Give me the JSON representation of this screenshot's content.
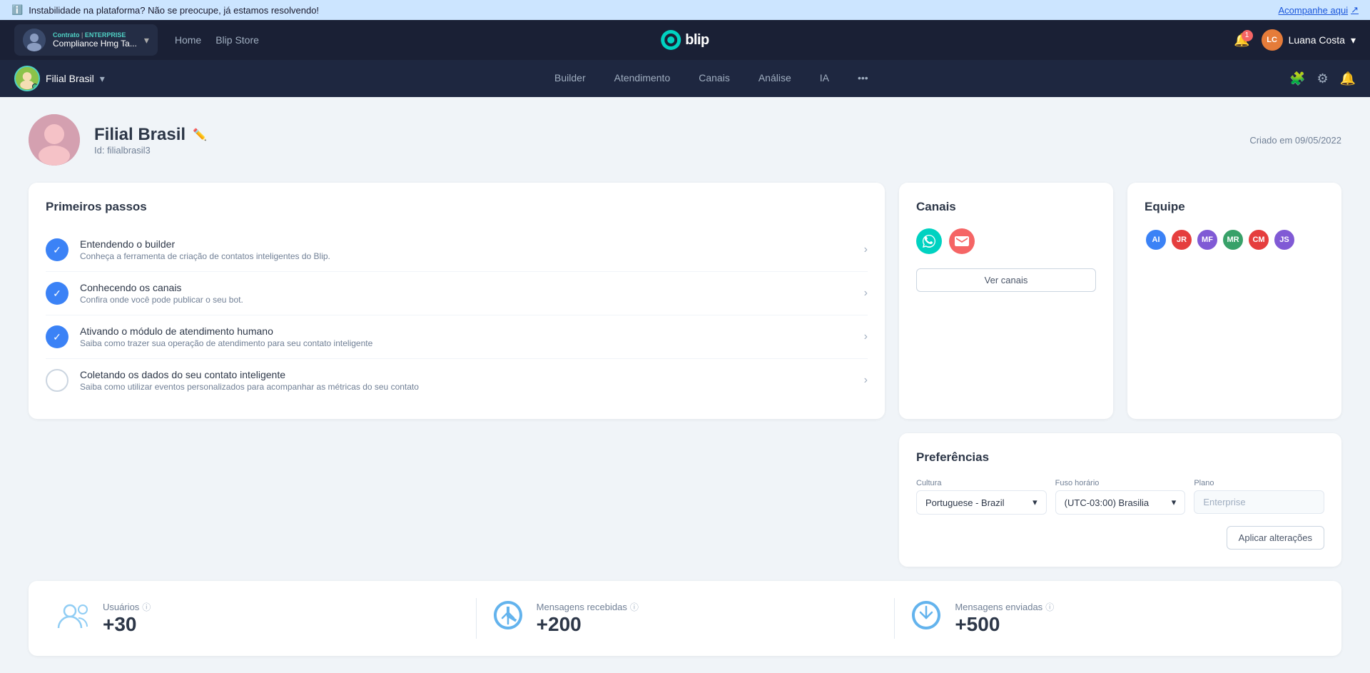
{
  "alert": {
    "message": "Instabilidade na plataforma? Não se preocupe, já estamos resolvendo!",
    "link_text": "Acompanhe aqui",
    "info_icon": "ℹ"
  },
  "top_nav": {
    "contract_badge": "Contrato",
    "contract_tier": "ENTERPRISE",
    "contract_name": "Compliance Hmg Ta...",
    "links": [
      {
        "label": "Home",
        "active": false
      },
      {
        "label": "Blip Store",
        "active": false
      }
    ],
    "logo_text": "blip",
    "notifications_count": "1",
    "user_name": "Luana Costa",
    "user_initials": "LC"
  },
  "sub_nav": {
    "bot_name": "Filial Brasil",
    "links": [
      {
        "label": "Builder",
        "active": false
      },
      {
        "label": "Atendimento",
        "active": false
      },
      {
        "label": "Canais",
        "active": false
      },
      {
        "label": "Análise",
        "active": false
      },
      {
        "label": "IA",
        "active": false
      },
      {
        "label": "•••",
        "active": false
      }
    ]
  },
  "profile": {
    "name": "Filial Brasil",
    "id": "Id: filialbrasil3",
    "created": "Criado em  09/05/2022"
  },
  "primeiros_passos": {
    "title": "Primeiros passos",
    "steps": [
      {
        "title": "Entendendo o builder",
        "desc": "Conheça a ferramenta de criação de contatos inteligentes do Blip.",
        "completed": true
      },
      {
        "title": "Conhecendo os canais",
        "desc": "Confira onde você pode publicar o seu bot.",
        "completed": true
      },
      {
        "title": "Ativando o módulo de atendimento humano",
        "desc": "Saiba como trazer sua operação de atendimento para seu contato inteligente",
        "completed": true
      },
      {
        "title": "Coletando os dados do seu contato inteligente",
        "desc": "Saiba como utilizar eventos personalizados para acompanhar as métricas do seu contato",
        "completed": false
      }
    ]
  },
  "canais": {
    "title": "Canais",
    "ver_canais": "Ver canais"
  },
  "equipe": {
    "title": "Equipe",
    "members": [
      {
        "initials": "AI",
        "color": "#3b82f6"
      },
      {
        "initials": "JR",
        "color": "#e53e3e"
      },
      {
        "initials": "MF",
        "color": "#805ad5"
      },
      {
        "initials": "MR",
        "color": "#38a169"
      },
      {
        "initials": "CM",
        "color": "#e53e3e"
      },
      {
        "initials": "JS",
        "color": "#805ad5"
      }
    ]
  },
  "preferencias": {
    "title": "Preferências",
    "cultura_label": "Cultura",
    "cultura_value": "Portuguese - Brazil",
    "fuso_label": "Fuso horário",
    "fuso_value": "(UTC-03:00) Brasilia",
    "plano_label": "Plano",
    "plano_value": "Enterprise",
    "aplicar_btn": "Aplicar alterações"
  },
  "stats": [
    {
      "label": "Usuários",
      "value": "+30",
      "icon": "users"
    },
    {
      "label": "Mensagens recebidas",
      "value": "+200",
      "icon": "inbox"
    },
    {
      "label": "Mensagens enviadas",
      "value": "+500",
      "icon": "outbox"
    }
  ]
}
